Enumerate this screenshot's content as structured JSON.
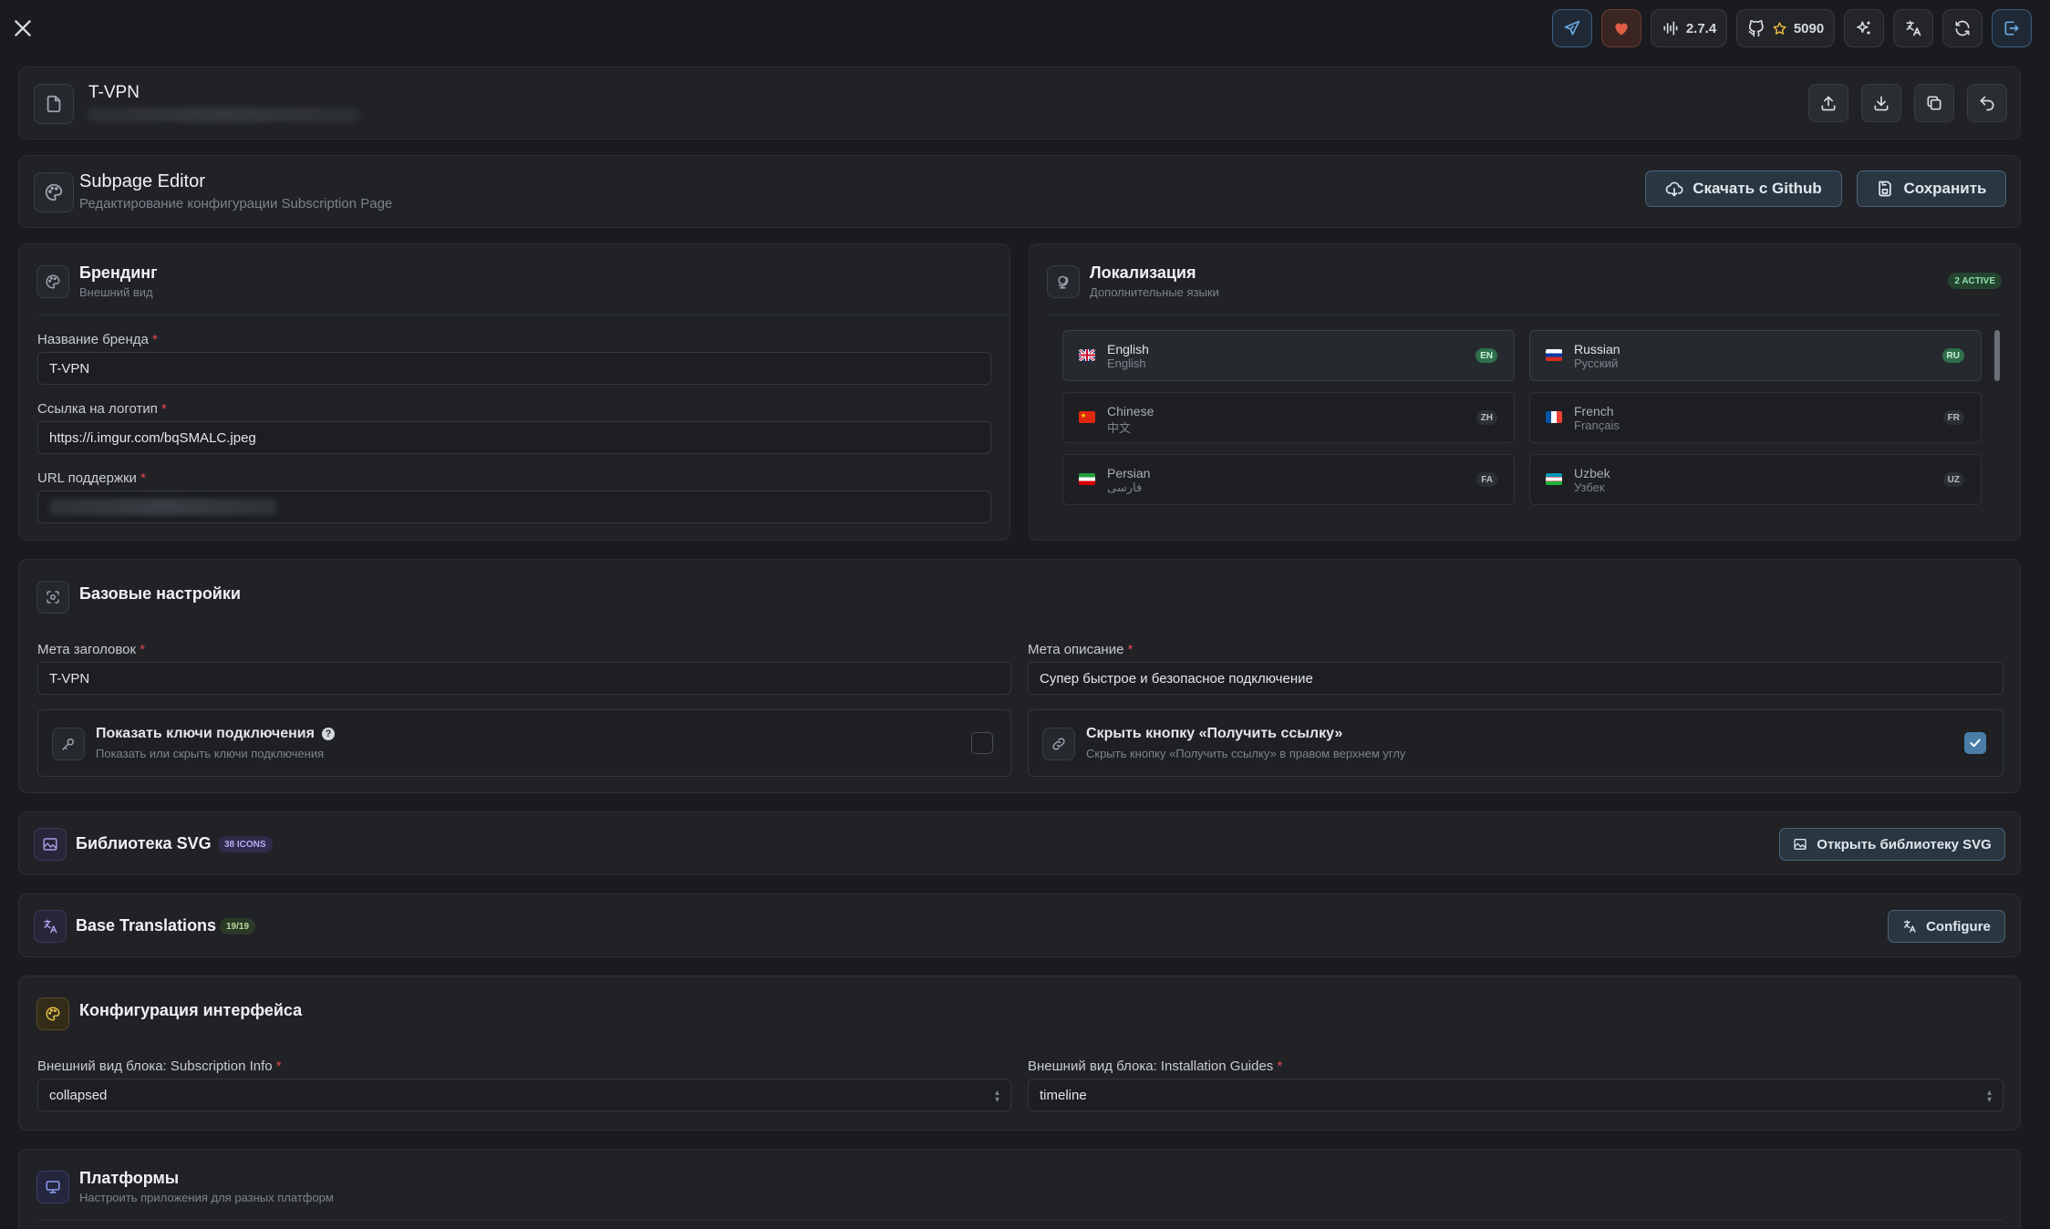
{
  "header": {
    "version": "2.7.4",
    "stars": "5090"
  },
  "profile": {
    "title": "T-VPN"
  },
  "editor": {
    "title": "Subpage Editor",
    "subtitle": "Редактирование конфигурации Subscription Page",
    "download_label": "Скачать с Github",
    "save_label": "Сохранить"
  },
  "branding": {
    "title": "Брендинг",
    "subtitle": "Внешний вид",
    "brand_label": "Название бренда",
    "brand_value": "T-VPN",
    "logo_label": "Ссылка на логотип",
    "logo_value": "https://i.imgur.com/bqSMALC.jpeg",
    "support_label": "URL поддержки",
    "req": "*"
  },
  "localization": {
    "title": "Локализация",
    "subtitle": "Дополнительные языки",
    "badge": "2 ACTIVE",
    "languages": [
      {
        "name": "English",
        "native": "English",
        "code": "EN"
      },
      {
        "name": "Russian",
        "native": "Русский",
        "code": "RU"
      },
      {
        "name": "Chinese",
        "native": "中文",
        "code": "ZH"
      },
      {
        "name": "French",
        "native": "Français",
        "code": "FR"
      },
      {
        "name": "Persian",
        "native": "فارسی",
        "code": "FA"
      },
      {
        "name": "Uzbek",
        "native": "Узбек",
        "code": "UZ"
      }
    ]
  },
  "base": {
    "title": "Базовые настройки",
    "meta_title_label": "Мета заголовок",
    "meta_title_value": "T-VPN",
    "meta_desc_label": "Мета описание",
    "meta_desc_value": "Супер быстрое и безопасное подключение",
    "show_keys_title": "Показать ключи подключения",
    "show_keys_sub": "Показать или скрыть ключи подключения",
    "hide_link_title": "Скрыть кнопку «Получить ссылку»",
    "hide_link_sub": "Скрыть кнопку «Получить ссылку» в правом верхнем углу"
  },
  "svg": {
    "title": "Библиотека SVG",
    "badge": "38 ICONS",
    "button": "Открыть библиотеку SVG"
  },
  "translations": {
    "title": "Base Translations",
    "badge": "19/19",
    "button": "Configure"
  },
  "ui_config": {
    "title": "Конфигурация интерфейса",
    "info_label": "Внешний вид блока: Subscription Info",
    "info_value": "collapsed",
    "guides_label": "Внешний вид блока: Installation Guides",
    "guides_value": "timeline"
  },
  "platforms": {
    "title": "Платформы",
    "subtitle": "Настроить приложения для разных платформ"
  },
  "colors": {
    "accent": "#5a9bd5",
    "favorite": "#e05d44",
    "active_badge": "#2f6f4c",
    "checkbox": "#4a7ea8"
  }
}
